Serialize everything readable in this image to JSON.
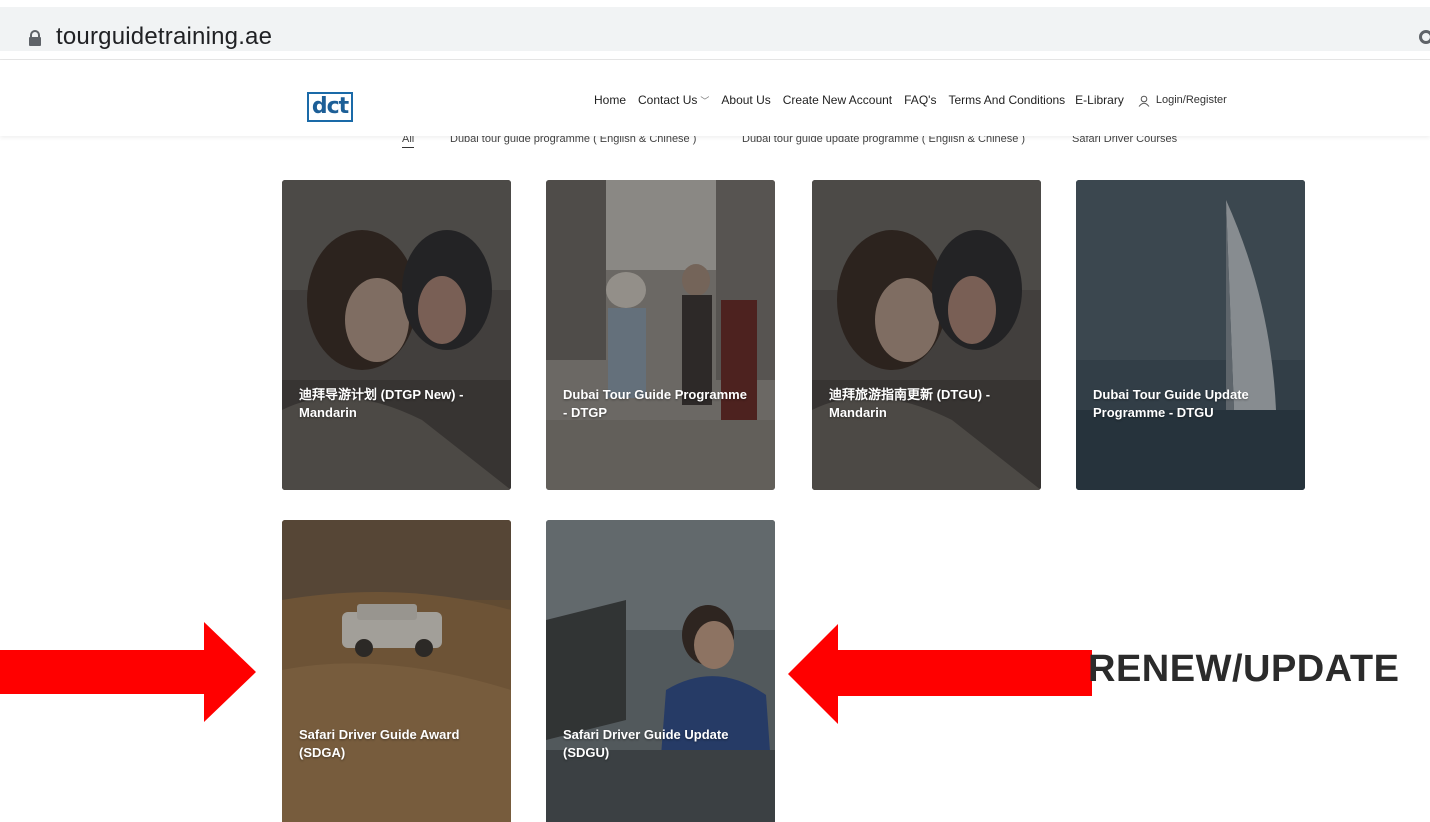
{
  "browser": {
    "url": "tourguidetraining.ae"
  },
  "header": {
    "logo_text": "dct",
    "nav": {
      "home": "Home",
      "contact": "Contact Us",
      "about": "About Us",
      "create": "Create New Account",
      "faq": "FAQ's",
      "terms": "Terms And Conditions",
      "elibrary": "E-Library",
      "login": "Login/Register"
    }
  },
  "filters": {
    "all": "All",
    "f1": "Dubai tour guide programme ( English & Chinese )",
    "f2": "Dubai tour guide update programme ( English & Chinese )",
    "f3": "Safari Driver Courses"
  },
  "courses": [
    {
      "title_line1": "迪拜导游计划 (DTGP New) -",
      "title_line2": "Mandarin"
    },
    {
      "title_line1": "Dubai Tour Guide Programme",
      "title_line2": "- DTGP"
    },
    {
      "title_line1": "迪拜旅游指南更新 (DTGU) -",
      "title_line2": "Mandarin"
    },
    {
      "title_line1": "Dubai Tour Guide Update",
      "title_line2": "Programme - DTGU"
    },
    {
      "title_line1": "Safari Driver Guide Award",
      "title_line2": "(SDGA)"
    },
    {
      "title_line1": "Safari Driver Guide Update",
      "title_line2": "(SDGU)"
    }
  ],
  "annotation": {
    "text": "RENEW/UPDATE",
    "arrow_color": "#ff0000"
  }
}
